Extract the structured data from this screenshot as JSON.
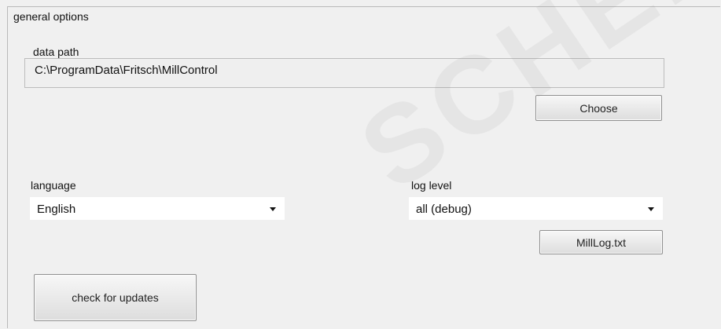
{
  "group": {
    "title": "general options"
  },
  "data_path": {
    "label": "data path",
    "value": "C:\\ProgramData\\Fritsch\\MillControl",
    "choose_label": "Choose"
  },
  "language": {
    "label": "language",
    "selected": "English"
  },
  "log_level": {
    "label": "log level",
    "selected": "all (debug)",
    "log_button_label": "MillLog.txt"
  },
  "updates": {
    "button_label": "check for updates"
  },
  "watermark": {
    "text": "SCHER SA"
  }
}
